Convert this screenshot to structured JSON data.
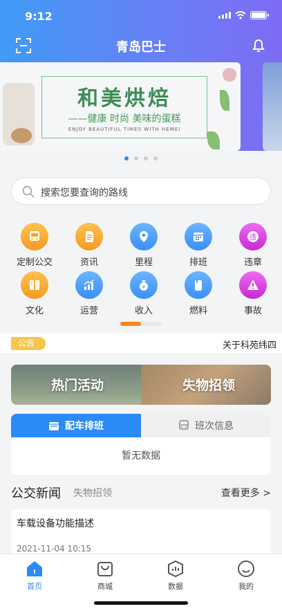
{
  "status": {
    "time": "9:12"
  },
  "nav": {
    "title": "青岛巴士"
  },
  "banner": {
    "title": "和美烘焙",
    "subtitle": "——健康 时尚 美味的蛋糕",
    "tagline": "ENJOY BEAUTIFUL TIMES WITH HEMEI"
  },
  "search": {
    "placeholder": "搜索您要查询的路线"
  },
  "grid": [
    {
      "label": "定制公交",
      "icon": "bus-icon",
      "color": "#f5a623"
    },
    {
      "label": "资讯",
      "icon": "document-icon",
      "color": "#f5a623"
    },
    {
      "label": "里程",
      "icon": "location-pin-icon",
      "color": "#3a8ff7"
    },
    {
      "label": "排班",
      "icon": "calendar-icon",
      "color": "#3a8ff7"
    },
    {
      "label": "违章",
      "icon": "violation-icon",
      "color": "#d63adf"
    },
    {
      "label": "文化",
      "icon": "book-icon",
      "color": "#f5a623"
    },
    {
      "label": "运营",
      "icon": "chart-up-icon",
      "color": "#3a8ff7"
    },
    {
      "label": "收入",
      "icon": "money-bag-icon",
      "color": "#3a8ff7"
    },
    {
      "label": "燃料",
      "icon": "fuel-icon",
      "color": "#3a8ff7"
    },
    {
      "label": "事故",
      "icon": "warning-icon",
      "color": "#d63adf"
    }
  ],
  "notice": {
    "tag": "公告",
    "text": "关于科苑纬四"
  },
  "promo": {
    "left": "热门活动",
    "right": "失物招领"
  },
  "schedule": {
    "tab1": "配车排班",
    "tab2": "班次信息",
    "empty": "暂无数据"
  },
  "news": {
    "title": "公交新闻",
    "subtitle": "失物招领",
    "more": "查看更多 >",
    "item_title": "车载设备功能描述",
    "item_date": "2021-11-04 10:15"
  },
  "tabbar": {
    "home": "首页",
    "mall": "商城",
    "data": "数据",
    "mine": "我的"
  }
}
